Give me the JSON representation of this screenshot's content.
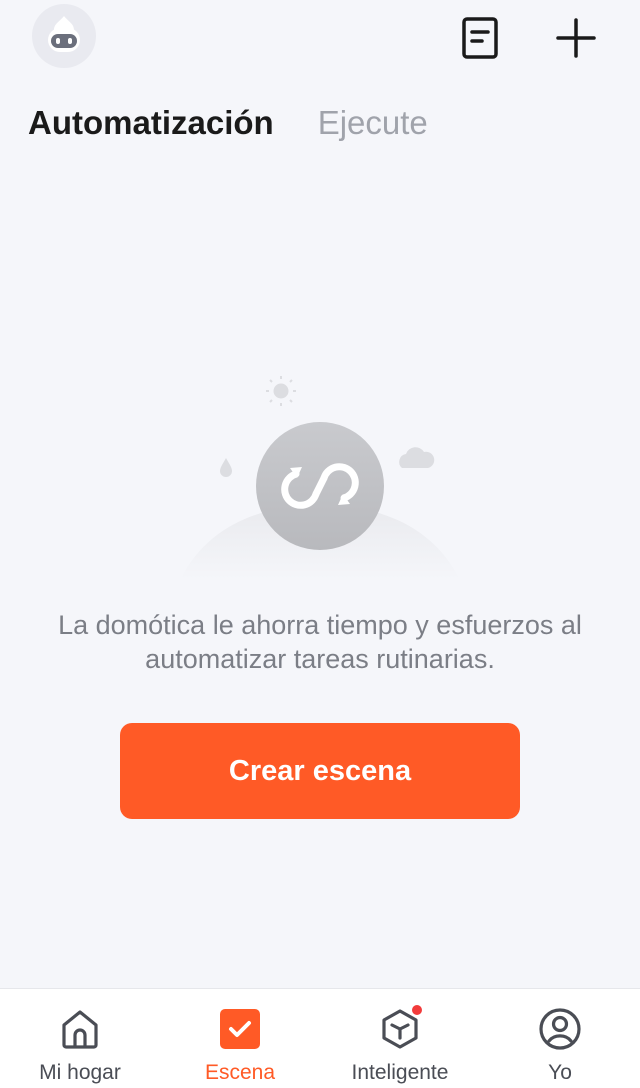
{
  "header": {
    "avatar_icon": "robot-face-icon",
    "log_icon": "document-list-icon",
    "add_icon": "plus-icon"
  },
  "tabs": [
    {
      "label": "Automatización",
      "active": true
    },
    {
      "label": "Ejecute",
      "active": false
    }
  ],
  "empty_state": {
    "illustration_icon": "automation-loop-icon",
    "message": "La domótica le ahorra tiempo y esfuerzos al automatizar tareas rutinarias.",
    "button_label": "Crear escena"
  },
  "bottom_nav": [
    {
      "label": "Mi hogar",
      "icon": "home-icon",
      "active": false
    },
    {
      "label": "Escena",
      "icon": "scene-check-icon",
      "active": true
    },
    {
      "label": "Inteligente",
      "icon": "cube-icon",
      "active": false,
      "badge": true
    },
    {
      "label": "Yo",
      "icon": "profile-icon",
      "active": false
    }
  ],
  "colors": {
    "accent": "#ff5a26",
    "background": "#f5f6fa",
    "badge": "#f23b3b"
  }
}
